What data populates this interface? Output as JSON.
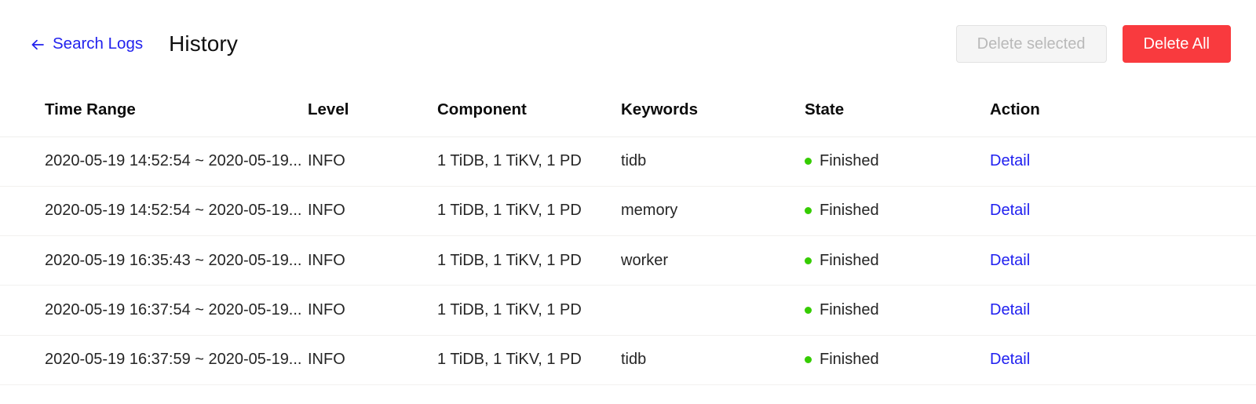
{
  "header": {
    "back_link": {
      "label": "Search Logs",
      "icon": "arrow-left-icon"
    },
    "title": "History",
    "actions": {
      "delete_selected_label": "Delete selected",
      "delete_all_label": "Delete All"
    }
  },
  "colors": {
    "link_blue": "#2020f0",
    "danger_red": "#f93a3e",
    "status_green": "#35cc00",
    "disabled_text": "#b9b9b9",
    "disabled_bg": "#f5f5f5",
    "row_border": "#f2f1ef"
  },
  "table": {
    "columns": [
      {
        "key": "time_range",
        "label": "Time Range"
      },
      {
        "key": "level",
        "label": "Level"
      },
      {
        "key": "component",
        "label": "Component"
      },
      {
        "key": "keywords",
        "label": "Keywords"
      },
      {
        "key": "state",
        "label": "State"
      },
      {
        "key": "action",
        "label": "Action"
      }
    ],
    "rows": [
      {
        "time_range": "2020-05-19 14:52:54 ~ 2020-05-19...",
        "level": "INFO",
        "component": "1 TiDB, 1 TiKV, 1 PD",
        "keywords": "tidb",
        "state": "Finished",
        "state_indicator": "green-dot-icon",
        "action": "Detail"
      },
      {
        "time_range": "2020-05-19 14:52:54 ~ 2020-05-19...",
        "level": "INFO",
        "component": "1 TiDB, 1 TiKV, 1 PD",
        "keywords": "memory",
        "state": "Finished",
        "state_indicator": "green-dot-icon",
        "action": "Detail"
      },
      {
        "time_range": "2020-05-19 16:35:43 ~ 2020-05-19...",
        "level": "INFO",
        "component": "1 TiDB, 1 TiKV, 1 PD",
        "keywords": "worker",
        "state": "Finished",
        "state_indicator": "green-dot-icon",
        "action": "Detail"
      },
      {
        "time_range": "2020-05-19 16:37:54 ~ 2020-05-19...",
        "level": "INFO",
        "component": "1 TiDB, 1 TiKV, 1 PD",
        "keywords": "",
        "state": "Finished",
        "state_indicator": "green-dot-icon",
        "action": "Detail"
      },
      {
        "time_range": "2020-05-19 16:37:59 ~ 2020-05-19...",
        "level": "INFO",
        "component": "1 TiDB, 1 TiKV, 1 PD",
        "keywords": "tidb",
        "state": "Finished",
        "state_indicator": "green-dot-icon",
        "action": "Detail"
      }
    ]
  }
}
